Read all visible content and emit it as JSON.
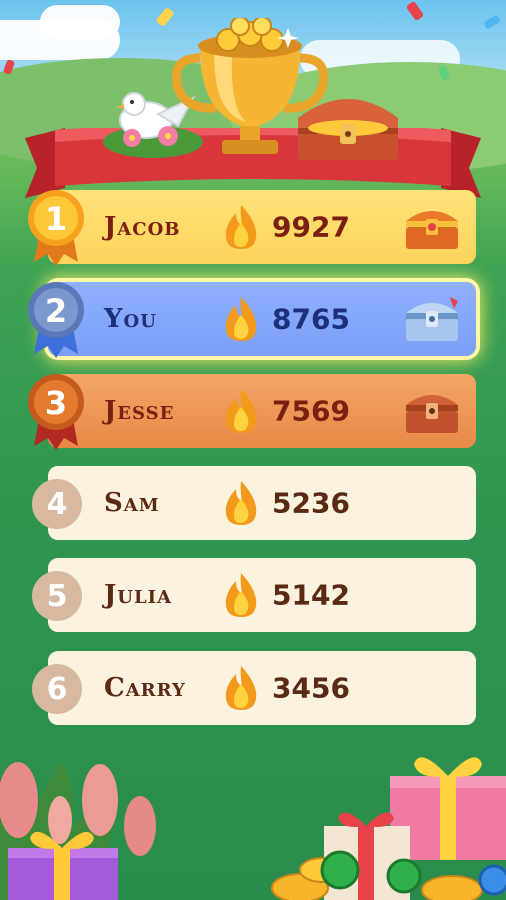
{
  "leaderboard": {
    "rows": [
      {
        "rank": "1",
        "name": "Jacob",
        "score": "9927"
      },
      {
        "rank": "2",
        "name": "You",
        "score": "8765"
      },
      {
        "rank": "3",
        "name": "Jesse",
        "score": "7569"
      },
      {
        "rank": "4",
        "name": "Sam",
        "score": "5236"
      },
      {
        "rank": "5",
        "name": "Julia",
        "score": "5142"
      },
      {
        "rank": "6",
        "name": "Carry",
        "score": "3456"
      }
    ]
  },
  "colors": {
    "gold_row": "#fdd35a",
    "you_row": "#7c9ff7",
    "bronze_row": "#e88a48",
    "plain_row": "#fbf2e0",
    "name_dark": "#7a1f12",
    "you_text": "#1f2f7a"
  },
  "icons": [
    "trophy-icon",
    "dove-icon",
    "treasure-chest-icon",
    "flame-icon",
    "gift-box-icon",
    "coin-icon"
  ]
}
